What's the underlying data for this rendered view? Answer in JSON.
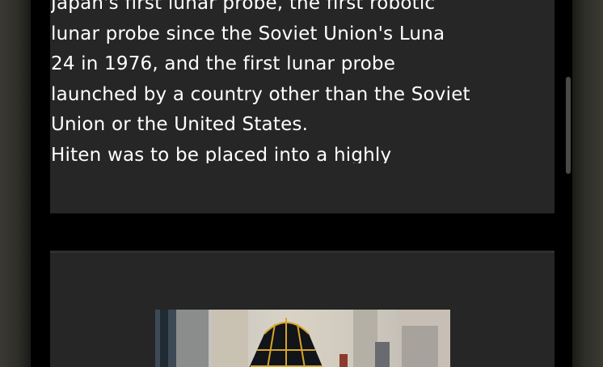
{
  "article": {
    "lines": [
      "Japan's first lunar probe, the first robotic",
      "lunar probe since the Soviet Union's Luna",
      "24 in 1976, and the first lunar probe",
      "launched by a country other than the Soviet",
      "Union or the United States.",
      "Hiten was to be placed into a highly"
    ]
  },
  "colors": {
    "card": "#262626",
    "background": "#000000",
    "text": "#ffffff"
  },
  "image": {
    "icon": "spacecraft-photo"
  }
}
